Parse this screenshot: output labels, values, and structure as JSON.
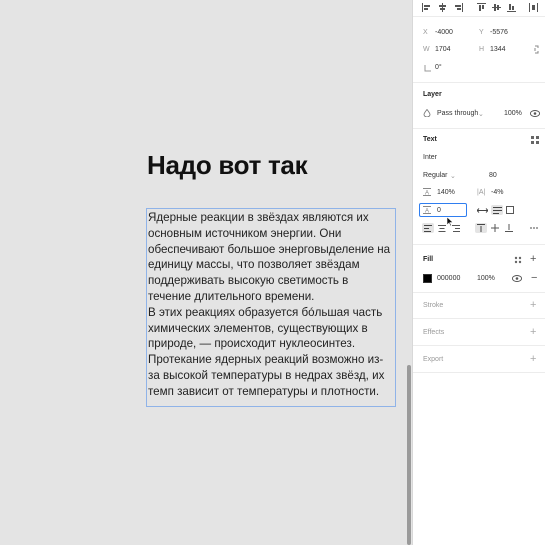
{
  "canvas": {
    "heading": "Надо вот так",
    "paragraph_lines": [
      "Ядерные реакции в звёздах являются их",
      "основным источником энергии. Они",
      "обеспечивают большое энерговыделение на",
      "единицу массы, что позволяет звёздам",
      "поддерживать высокую светимость в",
      "течение длительного времени.",
      "В этих реакциях образуется бóльшая часть",
      "химических элементов, существующих в",
      "природе, — происходит нуклеосинтез.",
      "Протекание ядерных реакций возможно из-",
      "за высокой температуры в недрах звёзд, их",
      "темп зависит от температуры и плотности."
    ]
  },
  "panel": {
    "alignment_icons": [
      "align-left-icon",
      "align-center-h-icon",
      "align-right-icon",
      "align-top-icon",
      "align-middle-v-icon",
      "align-bottom-icon",
      "distribute-icon"
    ],
    "frame": {
      "x_label": "X",
      "x_value": "-4000",
      "y_label": "Y",
      "y_value": "-5576",
      "w_label": "W",
      "w_value": "1704",
      "h_label": "H",
      "h_value": "1344",
      "rotation_value": "0°"
    },
    "layer": {
      "title": "Layer",
      "blend_mode": "Pass through",
      "opacity": "100%"
    },
    "text": {
      "title": "Text",
      "font_family": "Inter",
      "font_style": "Regular",
      "font_size": "80",
      "line_height": "140%",
      "letter_spacing": "-4%",
      "paragraph_spacing": "0"
    },
    "fill": {
      "title": "Fill",
      "hex": "000000",
      "opacity": "100%",
      "color": "#000000"
    },
    "stroke": {
      "title": "Stroke"
    },
    "effects": {
      "title": "Effects"
    },
    "export": {
      "title": "Export"
    }
  },
  "colors": {
    "selection": "#8fb3e8",
    "focus": "#2f7ef0"
  }
}
